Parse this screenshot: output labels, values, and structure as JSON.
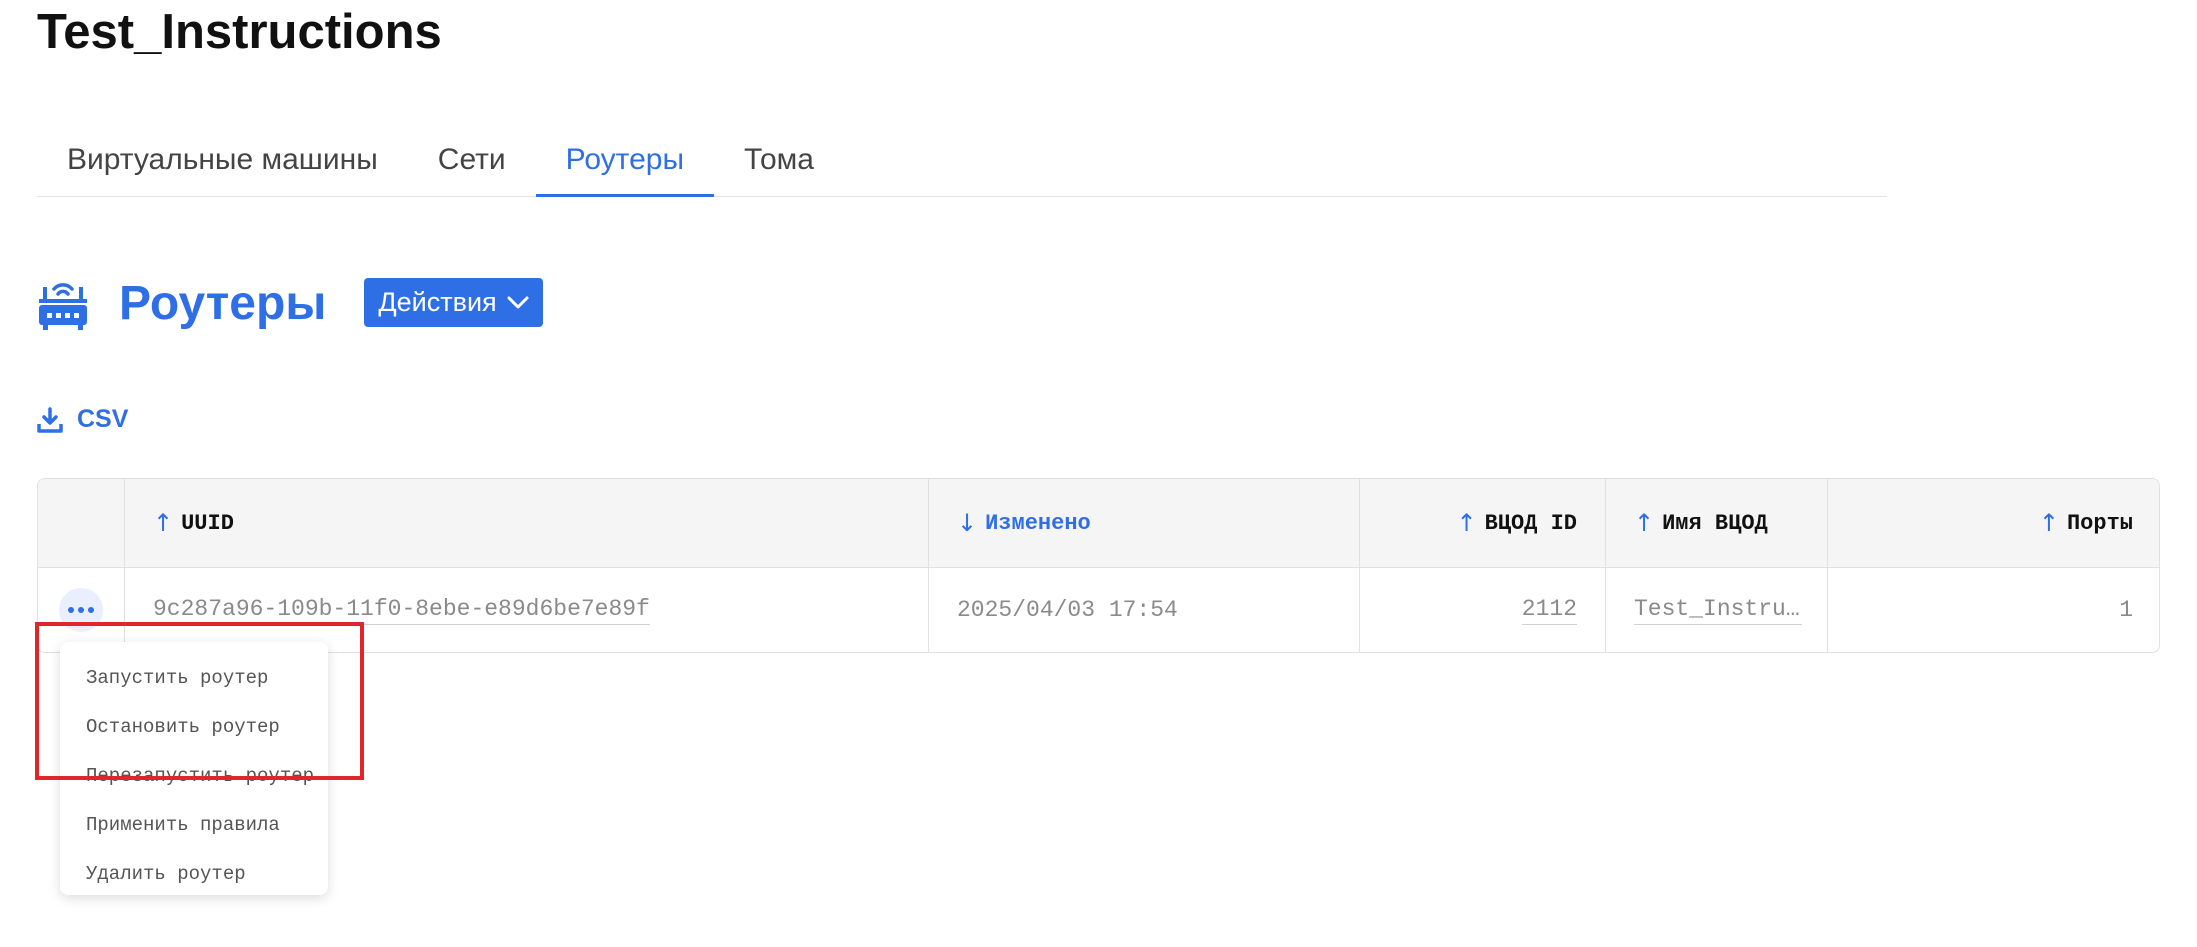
{
  "page": {
    "title": "Test_Instructions"
  },
  "tabs": [
    {
      "label": "Виртуальные машины",
      "active": false
    },
    {
      "label": "Сети",
      "active": false
    },
    {
      "label": "Роутеры",
      "active": true
    },
    {
      "label": "Тома",
      "active": false
    }
  ],
  "section": {
    "title": "Роутеры",
    "icon": "router-icon",
    "actions_label": "Действия",
    "actions_icon": "chevron-down-icon"
  },
  "csv": {
    "label": "CSV",
    "icon": "download-icon"
  },
  "table": {
    "columns": [
      {
        "label": "UUID",
        "sort": "asc"
      },
      {
        "label": "Изменено",
        "sort": "desc",
        "active": true
      },
      {
        "label": "ВЦОД ID",
        "sort": "asc"
      },
      {
        "label": "Имя ВЦОД",
        "sort": "asc"
      },
      {
        "label": "Порты",
        "sort": "asc"
      }
    ],
    "sort_arrows": {
      "asc": "↑",
      "desc": "↓"
    },
    "rows": [
      {
        "uuid": "9c287a96-109b-11f0-8ebe-e89d6be7e89f",
        "modified": "2025/04/03 17:54",
        "vdc_id": "2112",
        "vdc_name": "Test_Instructions",
        "ports": "1"
      }
    ]
  },
  "row_menu": {
    "items": [
      "Запустить роутер",
      "Остановить роутер",
      "Перезапустить роутер",
      "Применить правила",
      "Удалить роутер"
    ]
  },
  "colors": {
    "accent": "#2f6fe6",
    "highlight": "#e0252b",
    "header_bg": "#f5f5f5"
  }
}
